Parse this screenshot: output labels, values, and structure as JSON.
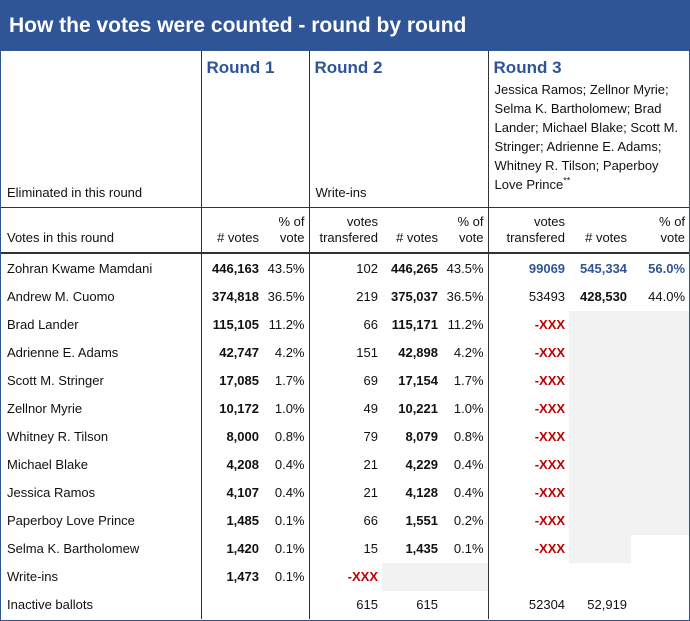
{
  "title": "How the votes were counted - round by round",
  "rounds": {
    "r1": "Round 1",
    "r2": "Round 2",
    "r3": "Round 3"
  },
  "eliminated": {
    "label": "Eliminated in this round",
    "r2": "Write-ins",
    "r3": "Jessica Ramos; Zellnor Myrie; Selma K. Bartholomew; Brad Lander; Michael Blake; Scott M. Stringer; Adrienne E. Adams; Whitney R. Tilson; Paperboy Love Prince",
    "r3_mark": "**"
  },
  "columns": {
    "row_label": "Votes in this round",
    "votes": "# votes",
    "pct_top": "% of",
    "pct_bottom": "vote",
    "transfer_top": "votes",
    "transfer_bottom": "transfered"
  },
  "rows": [
    {
      "name": "Zohran Kwame Mamdani",
      "r1v": "446,163",
      "r1p": "43.5%",
      "r2t": "102",
      "r2v": "446,265",
      "r2p": "43.5%",
      "r3t": "99069",
      "r3v": "545,334",
      "r3p": "56.0%"
    },
    {
      "name": "Andrew M. Cuomo",
      "r1v": "374,818",
      "r1p": "36.5%",
      "r2t": "219",
      "r2v": "375,037",
      "r2p": "36.5%",
      "r3t": "53493",
      "r3v": "428,530",
      "r3p": "44.0%"
    },
    {
      "name": "Brad Lander",
      "r1v": "115,105",
      "r1p": "11.2%",
      "r2t": "66",
      "r2v": "115,171",
      "r2p": "11.2%",
      "r3t": "-XXX"
    },
    {
      "name": "Adrienne E. Adams",
      "r1v": "42,747",
      "r1p": "4.2%",
      "r2t": "151",
      "r2v": "42,898",
      "r2p": "4.2%",
      "r3t": "-XXX"
    },
    {
      "name": "Scott M. Stringer",
      "r1v": "17,085",
      "r1p": "1.7%",
      "r2t": "69",
      "r2v": "17,154",
      "r2p": "1.7%",
      "r3t": "-XXX"
    },
    {
      "name": "Zellnor Myrie",
      "r1v": "10,172",
      "r1p": "1.0%",
      "r2t": "49",
      "r2v": "10,221",
      "r2p": "1.0%",
      "r3t": "-XXX"
    },
    {
      "name": "Whitney R. Tilson",
      "r1v": "8,000",
      "r1p": "0.8%",
      "r2t": "79",
      "r2v": "8,079",
      "r2p": "0.8%",
      "r3t": "-XXX"
    },
    {
      "name": "Michael Blake",
      "r1v": "4,208",
      "r1p": "0.4%",
      "r2t": "21",
      "r2v": "4,229",
      "r2p": "0.4%",
      "r3t": "-XXX"
    },
    {
      "name": "Jessica Ramos",
      "r1v": "4,107",
      "r1p": "0.4%",
      "r2t": "21",
      "r2v": "4,128",
      "r2p": "0.4%",
      "r3t": "-XXX"
    },
    {
      "name": "Paperboy Love Prince",
      "r1v": "1,485",
      "r1p": "0.1%",
      "r2t": "66",
      "r2v": "1,551",
      "r2p": "0.2%",
      "r3t": "-XXX"
    },
    {
      "name": "Selma K. Bartholomew",
      "r1v": "1,420",
      "r1p": "0.1%",
      "r2t": "15",
      "r2v": "1,435",
      "r2p": "0.1%",
      "r3t": "-XXX"
    },
    {
      "name": "Write-ins",
      "r1v": "1,473",
      "r1p": "0.1%",
      "r2t": "-XXX"
    },
    {
      "name": "Inactive ballots",
      "r2t": "615",
      "r2v": "615",
      "r3t": "52304",
      "r3v": "52,919"
    }
  ],
  "colors": {
    "header_bg": "#2f5597",
    "round_title": "#2f5597",
    "eliminated_mark": "#c00000",
    "greyed_cell": "#f2f2f2"
  }
}
